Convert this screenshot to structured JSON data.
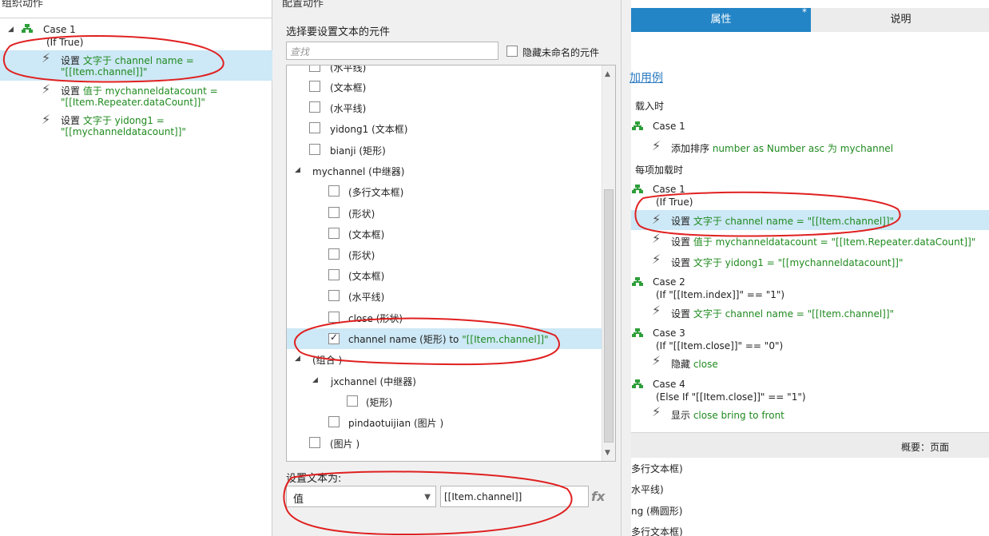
{
  "left_panel": {
    "header": "组织动作",
    "case1": {
      "title": "Case 1",
      "cond": "(If True)"
    },
    "actions": [
      {
        "prefix": "设置 ",
        "green": "文字于 channel name =",
        "line2": "\"[[Item.channel]]\""
      },
      {
        "prefix": "设置 ",
        "green": "值于",
        "rest": " mychanneldatacount =",
        "line2": "\"[[Item.Repeater.dataCount]]\""
      },
      {
        "prefix": "设置 ",
        "green": "文字于",
        "rest": " yidong1 =",
        "line2": "\"[[mychanneldatacount]]\""
      }
    ]
  },
  "middle_panel": {
    "header": "配置动作",
    "select_label": "选择要设置文本的元件",
    "search_placeholder": "查找",
    "hide_unnamed": "隐藏未命名的元件",
    "items": [
      {
        "label": "(水平线)",
        "checked": false
      },
      {
        "label": "(文本框)",
        "checked": false
      },
      {
        "label": "(水平线)",
        "checked": false
      },
      {
        "label": "yidong1 (文本框)",
        "checked": false
      },
      {
        "label": "bianji (矩形)",
        "checked": false
      },
      {
        "label": "mychannel (中继器)"
      },
      {
        "label": "(多行文本框)",
        "checked": false
      },
      {
        "label": "(形状)",
        "checked": false
      },
      {
        "label": "(文本框)",
        "checked": false
      },
      {
        "label": "(形状)",
        "checked": false
      },
      {
        "label": "(文本框)",
        "checked": false
      },
      {
        "label": "(水平线)",
        "checked": false
      },
      {
        "label": "close (形状)",
        "checked": false
      },
      {
        "label": "channel name (矩形) to ",
        "green": "\"[[Item.channel]]\"",
        "checked": true
      },
      {
        "label": "(组合 )"
      },
      {
        "label": "jxchannel (中继器)"
      },
      {
        "label": "(矩形)",
        "checked": false
      },
      {
        "label": "pindaotuijian (图片 )",
        "checked": false
      },
      {
        "label": "(图片 )",
        "checked": false
      }
    ],
    "set_text_label": "设置文本为:",
    "value_type": "值",
    "value": "[[Item.channel]]",
    "fx": "fx"
  },
  "right_panel": {
    "tabs": {
      "properties": "属性",
      "star": "*",
      "notes": "说明"
    },
    "add_case": "加用例",
    "on_load": "载入时",
    "on_load_case": "Case 1",
    "on_load_action": {
      "prefix": "添加排序 ",
      "green": "number as Number asc 为 mychannel"
    },
    "on_item_load": "每项加载时",
    "cases": [
      {
        "title": "Case 1",
        "cond": "(If True)",
        "actions": [
          {
            "prefix": "设置 ",
            "green": "文字于 channel name = \"[[Item.channel]]\""
          },
          {
            "prefix": "设置 ",
            "green": "值于 mychanneldatacount = \"[[Item.Repeater.dataCount]]\""
          },
          {
            "prefix": "设置 ",
            "green": "文字于 yidong1 = \"[[mychanneldatacount]]\""
          }
        ]
      },
      {
        "title": "Case 2",
        "cond": "(If \"[[Item.index]]\" == \"1\")",
        "actions": [
          {
            "prefix": "设置 ",
            "green": "文字于 channel name = \"[[Item.channel]]\""
          }
        ]
      },
      {
        "title": "Case 3",
        "cond": "(If \"[[Item.close]]\" == \"0\")",
        "actions": [
          {
            "prefix": "隐藏 ",
            "green": "close"
          }
        ]
      },
      {
        "title": "Case 4",
        "cond": "(Else If \"[[Item.close]]\" == \"1\")",
        "actions": [
          {
            "prefix": "显示 ",
            "green": "close bring to front"
          }
        ]
      }
    ],
    "summary": "概要：页面",
    "outline": [
      "多行文本框)",
      "水平线)",
      "ng (椭圆形)",
      "多行文本框)"
    ]
  },
  "colors": {
    "accent": "#2384c6",
    "selection": "#cde8f6",
    "green_text": "#1f8a1f",
    "annotation": "#e02020"
  }
}
